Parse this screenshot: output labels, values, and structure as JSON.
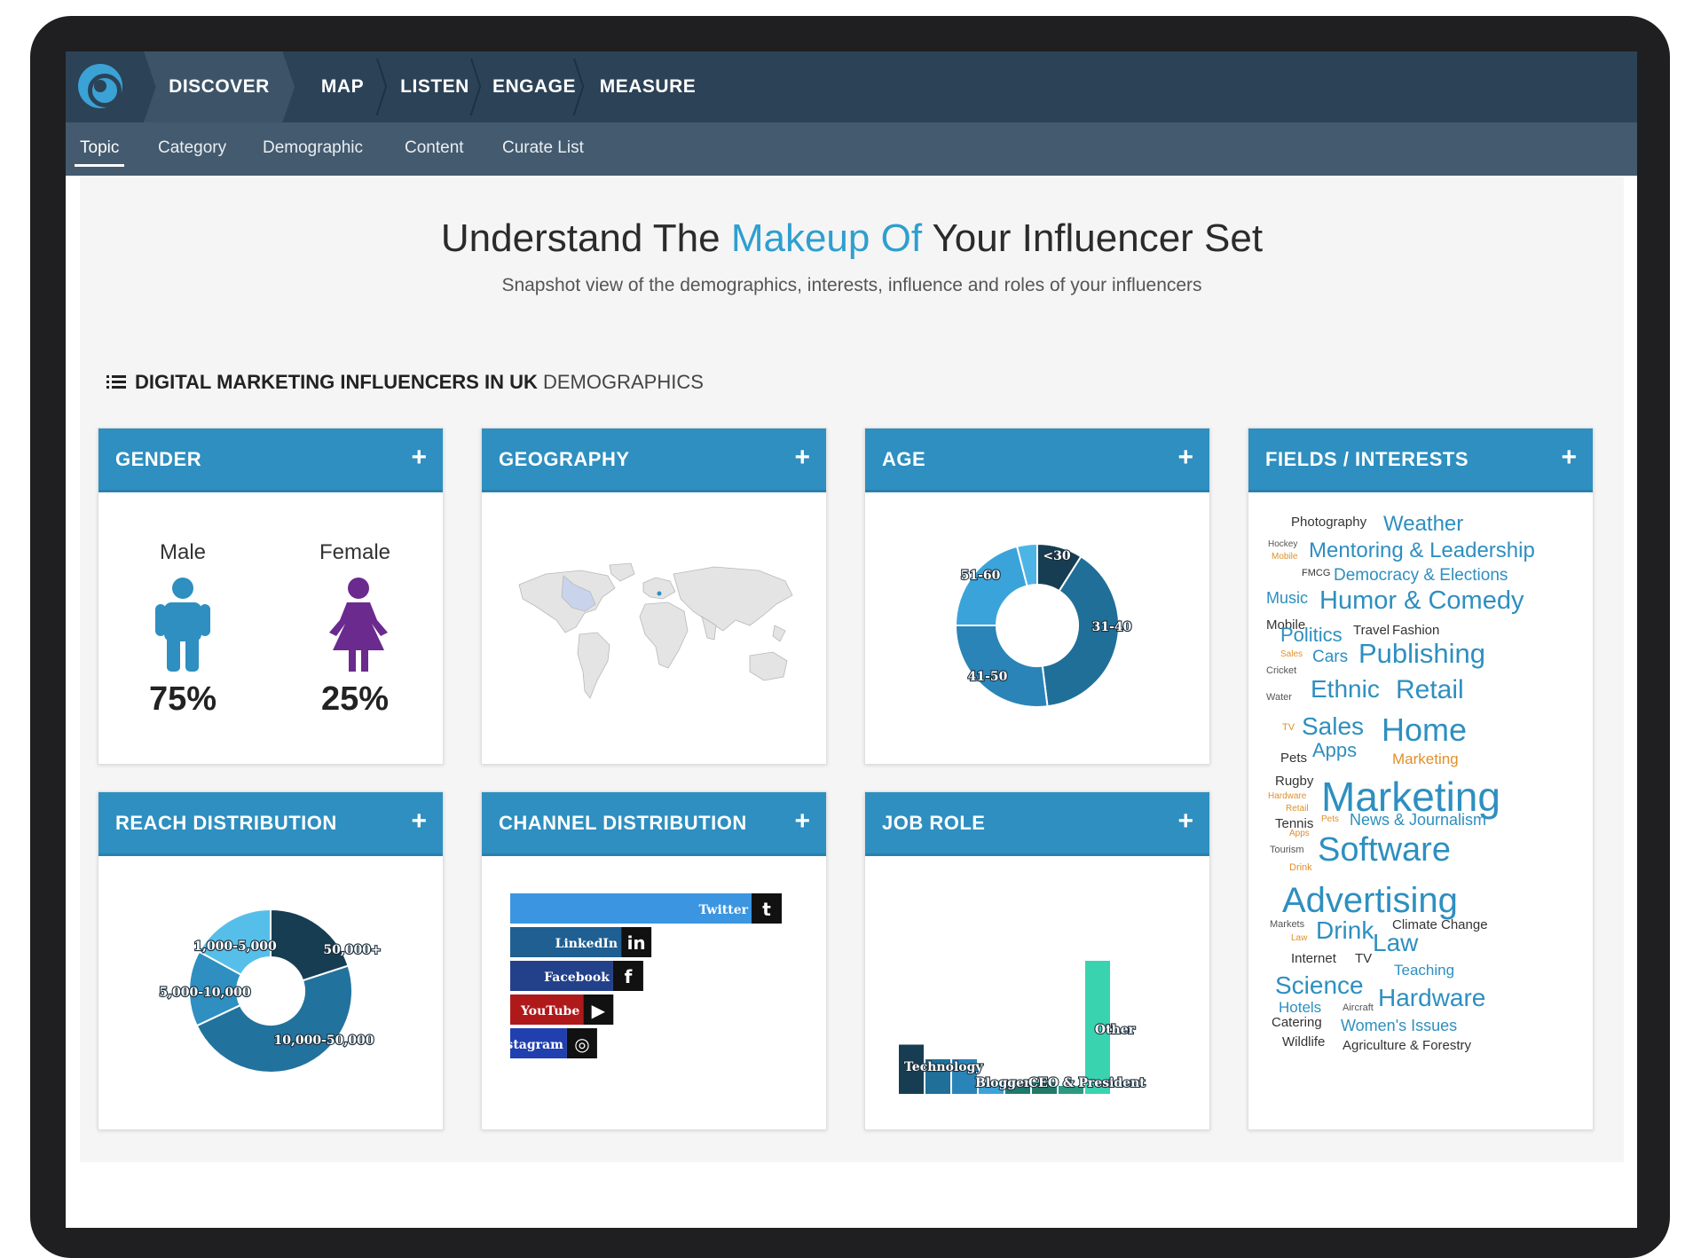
{
  "nav": {
    "items": [
      "DISCOVER",
      "MAP",
      "LISTEN",
      "ENGAGE",
      "MEASURE"
    ],
    "active": "DISCOVER"
  },
  "subnav": {
    "items": [
      "Topic",
      "Category",
      "Demographic",
      "Content",
      "Curate List"
    ],
    "active": "Topic"
  },
  "header": {
    "title_part1": "Understand The ",
    "title_accent": "Makeup Of",
    "title_part2": " Your Influencer Set",
    "subtitle": "Snapshot view of the demographics, interests, influence and roles of your influencers"
  },
  "section": {
    "title_bold": "DIGITAL MARKETING INFLUENCERS IN UK",
    "title_light": " DEMOGRAPHICS"
  },
  "cards": {
    "gender": "GENDER",
    "geography": "GEOGRAPHY",
    "age": "AGE",
    "fields": "FIELDS / INTERESTS",
    "reach": "REACH DISTRIBUTION",
    "channel": "CHANNEL DISTRIBUTION",
    "job": "JOB ROLE",
    "plus": "+"
  },
  "gender": {
    "male_label": "Male",
    "female_label": "Female",
    "male_pct": "75%",
    "female_pct": "25%",
    "male_color": "#2e8fc0",
    "female_color": "#6b2a8e"
  },
  "chart_data": [
    {
      "type": "pie",
      "name": "age",
      "labels": [
        "<30",
        "31-40",
        "41-50",
        "51-60",
        ""
      ],
      "values": [
        9,
        39,
        27,
        21,
        4
      ],
      "colors": [
        "#173d52",
        "#1f6f99",
        "#2a84b8",
        "#3aa4da",
        "#4db5e6"
      ]
    },
    {
      "type": "pie",
      "name": "reach",
      "labels": [
        "50,000+",
        "10,000-50,000",
        "5,000-10,000",
        "1,000-5,000"
      ],
      "values": [
        20,
        48,
        15,
        17
      ],
      "colors": [
        "#173d52",
        "#22729e",
        "#2e8fc0",
        "#56bfe9"
      ]
    },
    {
      "type": "bar",
      "name": "channel",
      "categories": [
        "Twitter",
        "LinkedIn",
        "Facebook",
        "YouTube",
        "Instagram"
      ],
      "values": [
        100,
        52,
        49,
        38,
        32
      ],
      "colors": [
        "#3b95e0",
        "#1f5f92",
        "#23408a",
        "#b0191a",
        "#2040b0"
      ]
    },
    {
      "type": "bar",
      "name": "job",
      "categories": [
        "Technology",
        "",
        "",
        "Blogger",
        "",
        "CEO & President",
        "",
        "Other"
      ],
      "values": [
        37,
        26,
        26,
        9,
        6,
        9,
        6,
        100
      ],
      "colors": [
        "#173d52",
        "#1f6f99",
        "#2a84b8",
        "#3aa4da",
        "#1d7a6e",
        "#217a67",
        "#2a9a80",
        "#39d3b0"
      ]
    }
  ],
  "cloud": [
    {
      "t": "Photography",
      "s": 15,
      "c": "#333"
    },
    {
      "t": "Weather",
      "s": 24,
      "c": "#2e8fc0"
    },
    {
      "t": "Hockey",
      "s": 10,
      "c": "#555"
    },
    {
      "t": "Mobile",
      "s": 10,
      "c": "#e0902a"
    },
    {
      "t": "Mentoring & Leadership",
      "s": 24,
      "c": "#2e8fc0"
    },
    {
      "t": "FMCG",
      "s": 11,
      "c": "#333"
    },
    {
      "t": "Democracy & Elections",
      "s": 19,
      "c": "#2e8fc0"
    },
    {
      "t": "Music",
      "s": 18,
      "c": "#2e8fc0"
    },
    {
      "t": "Humor & Comedy",
      "s": 29,
      "c": "#2e8fc0"
    },
    {
      "t": "Mobile",
      "s": 15,
      "c": "#333"
    },
    {
      "t": "Politics",
      "s": 22,
      "c": "#2e8fc0"
    },
    {
      "t": "Travel",
      "s": 15,
      "c": "#333"
    },
    {
      "t": "Fashion",
      "s": 15,
      "c": "#333"
    },
    {
      "t": "Sales",
      "s": 10,
      "c": "#e0902a"
    },
    {
      "t": "Cricket",
      "s": 11,
      "c": "#555"
    },
    {
      "t": "Cars",
      "s": 19,
      "c": "#2e8fc0"
    },
    {
      "t": "Publishing",
      "s": 31,
      "c": "#2e8fc0"
    },
    {
      "t": "Water",
      "s": 11,
      "c": "#555"
    },
    {
      "t": "Ethnic",
      "s": 28,
      "c": "#2e8fc0"
    },
    {
      "t": "Retail",
      "s": 30,
      "c": "#2e8fc0"
    },
    {
      "t": "TV",
      "s": 11,
      "c": "#e0902a"
    },
    {
      "t": "Sales",
      "s": 28,
      "c": "#2e8fc0"
    },
    {
      "t": "Home",
      "s": 36,
      "c": "#2e8fc0"
    },
    {
      "t": "Pets",
      "s": 15,
      "c": "#333"
    },
    {
      "t": "Apps",
      "s": 22,
      "c": "#2e8fc0"
    },
    {
      "t": "Marketing",
      "s": 17,
      "c": "#e0902a"
    },
    {
      "t": "Rugby",
      "s": 15,
      "c": "#333"
    },
    {
      "t": "Hardware",
      "s": 10,
      "c": "#e0902a"
    },
    {
      "t": "Retail",
      "s": 10,
      "c": "#e0902a"
    },
    {
      "t": "Marketing",
      "s": 46,
      "c": "#2e8fc0"
    },
    {
      "t": "Tennis",
      "s": 15,
      "c": "#333"
    },
    {
      "t": "Pets",
      "s": 10,
      "c": "#e0902a"
    },
    {
      "t": "News & Journalism",
      "s": 18,
      "c": "#2e8fc0"
    },
    {
      "t": "Apps",
      "s": 10,
      "c": "#e0902a"
    },
    {
      "t": "Tourism",
      "s": 11,
      "c": "#555"
    },
    {
      "t": "Software",
      "s": 38,
      "c": "#2e8fc0"
    },
    {
      "t": "Drink",
      "s": 11,
      "c": "#e0902a"
    },
    {
      "t": "Advertising",
      "s": 40,
      "c": "#2e8fc0"
    },
    {
      "t": "Markets",
      "s": 11,
      "c": "#555"
    },
    {
      "t": "Drink",
      "s": 28,
      "c": "#2e8fc0"
    },
    {
      "t": "Climate Change",
      "s": 15,
      "c": "#333"
    },
    {
      "t": "Law",
      "s": 10,
      "c": "#e0902a"
    },
    {
      "t": "Law",
      "s": 28,
      "c": "#2e8fc0"
    },
    {
      "t": "Internet",
      "s": 15,
      "c": "#333"
    },
    {
      "t": "TV",
      "s": 15,
      "c": "#333"
    },
    {
      "t": "Teaching",
      "s": 17,
      "c": "#2e8fc0"
    },
    {
      "t": "Science",
      "s": 28,
      "c": "#2e8fc0"
    },
    {
      "t": "Hardware",
      "s": 28,
      "c": "#2e8fc0"
    },
    {
      "t": "Hotels",
      "s": 17,
      "c": "#2e8fc0"
    },
    {
      "t": "Aircraft",
      "s": 11,
      "c": "#555"
    },
    {
      "t": "Catering",
      "s": 15,
      "c": "#333"
    },
    {
      "t": "Women's Issues",
      "s": 18,
      "c": "#2e8fc0"
    },
    {
      "t": "Wildlife",
      "s": 15,
      "c": "#333"
    },
    {
      "t": "Agriculture & Forestry",
      "s": 15,
      "c": "#333"
    }
  ]
}
